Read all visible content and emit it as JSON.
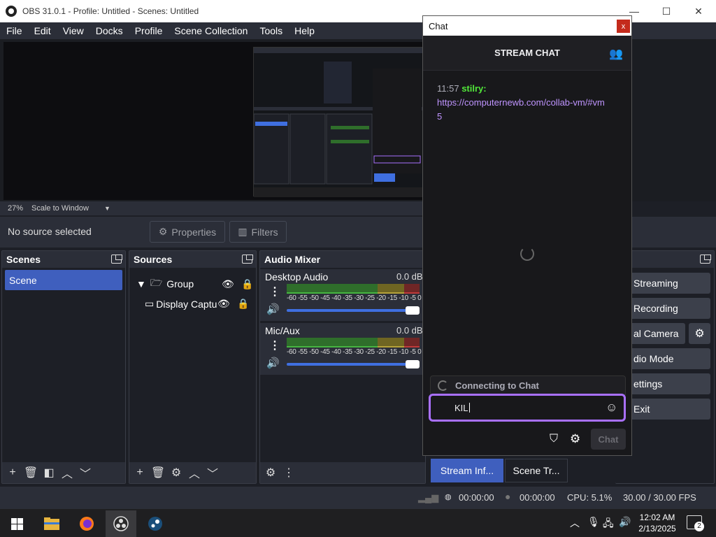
{
  "window": {
    "title": "OBS 31.0.1 - Profile: Untitled - Scenes: Untitled",
    "minimize": "—",
    "maximize": "☐",
    "close": "✕"
  },
  "menu": [
    "File",
    "Edit",
    "View",
    "Docks",
    "Profile",
    "Scene Collection",
    "Tools",
    "Help"
  ],
  "preview": {
    "zoom": "27%",
    "scale_mode": "Scale to Window"
  },
  "source_bar": {
    "status": "No source selected",
    "properties": "Properties",
    "filters": "Filters"
  },
  "scenes": {
    "title": "Scenes",
    "items": [
      "Scene"
    ]
  },
  "sources": {
    "title": "Sources",
    "items": [
      {
        "label": "Group"
      },
      {
        "label": "Display Captu"
      }
    ]
  },
  "mixer": {
    "title": "Audio Mixer",
    "scale": "-60 -55 -50 -45 -40 -35 -30 -25 -20 -15 -10 -5 0",
    "channels": [
      {
        "name": "Desktop Audio",
        "level": "0.0 dB"
      },
      {
        "name": "Mic/Aux",
        "level": "0.0 dB"
      }
    ]
  },
  "controls": {
    "streaming": "Streaming",
    "recording": "Recording",
    "camera": "al Camera",
    "studio": "dio Mode",
    "settings": "ettings",
    "exit": "Exit"
  },
  "bottom_tabs": {
    "stream_info": "Stream Inf...",
    "scene_transitions": "Scene Tr..."
  },
  "chat": {
    "window_title": "Chat",
    "close": "x",
    "header": "STREAM CHAT",
    "message": {
      "time": "11:57",
      "user": "stilry:",
      "text": "https://computernewb.com/collab-vm/#vm5"
    },
    "connecting": "Connecting to Chat",
    "input_value": "KIL",
    "send": "Chat"
  },
  "status": {
    "stream_time": "00:00:00",
    "rec_time": "00:00:00",
    "cpu": "CPU: 5.1%",
    "fps": "30.00 / 30.00 FPS"
  },
  "taskbar": {
    "time": "12:02 AM",
    "date": "2/13/2025",
    "notifications": "2"
  }
}
